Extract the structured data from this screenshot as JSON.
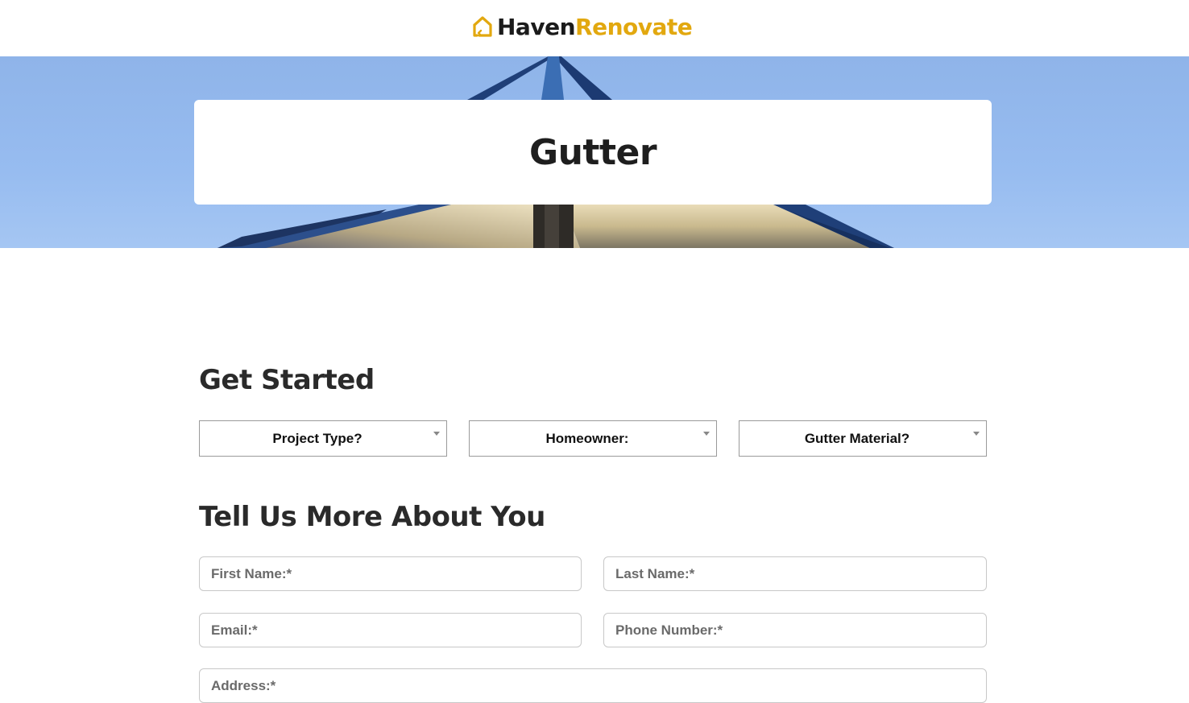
{
  "brand": {
    "name_part1": "Haven",
    "name_part2": "Renovate",
    "accent_color": "#e2a80f",
    "logo_icon": "house-icon"
  },
  "hero": {
    "title": "Gutter",
    "background_image": "house-roof-eave-against-blue-sky"
  },
  "get_started": {
    "heading": "Get Started",
    "selects": [
      {
        "label": "Project Type?"
      },
      {
        "label": "Homeowner:"
      },
      {
        "label": "Gutter Material?"
      }
    ]
  },
  "about_you": {
    "heading": "Tell Us More About You",
    "fields": {
      "first_name": {
        "placeholder": "First Name:*",
        "value": ""
      },
      "last_name": {
        "placeholder": "Last Name:*",
        "value": ""
      },
      "email": {
        "placeholder": "Email:*",
        "value": ""
      },
      "phone": {
        "placeholder": "Phone Number:*",
        "value": ""
      },
      "address": {
        "placeholder": "Address:*",
        "value": ""
      }
    }
  }
}
